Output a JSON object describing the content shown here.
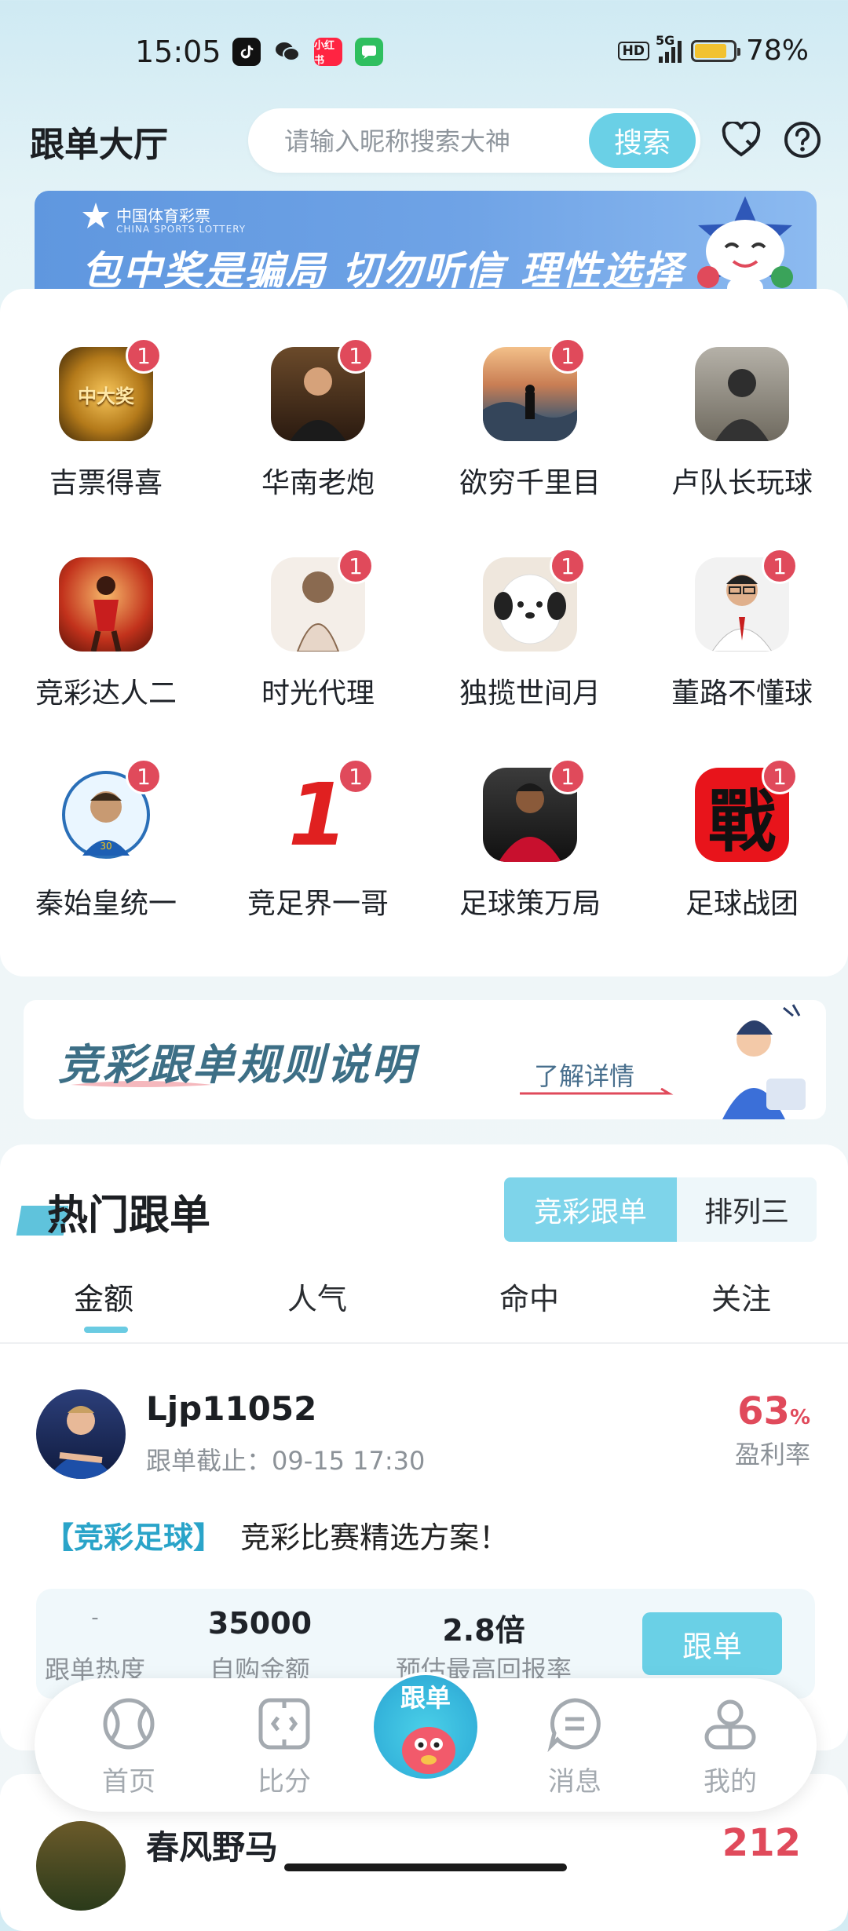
{
  "status_bar": {
    "time": "15:05",
    "network": "5G",
    "hd": "HD",
    "battery": "78%",
    "app_icon_labels": [
      "小红书"
    ]
  },
  "header": {
    "title": "跟单大厅",
    "search_placeholder": "请输入昵称搜索大神",
    "search_button": "搜索"
  },
  "banner": {
    "logo_cn": "中国体育彩票",
    "logo_en": "CHINA SPORTS LOTTERY",
    "slogan": "包中奖是骗局 切勿听信 理性选择"
  },
  "creators": [
    {
      "name": "吉票得喜",
      "badge": "1",
      "avatar_text": "中大奖"
    },
    {
      "name": "华南老炮",
      "badge": "1"
    },
    {
      "name": "欲穷千里目",
      "badge": "1"
    },
    {
      "name": "卢队长玩球",
      "badge": ""
    },
    {
      "name": "竞彩达人二",
      "badge": ""
    },
    {
      "name": "时光代理",
      "badge": "1"
    },
    {
      "name": "独揽世间月",
      "badge": "1"
    },
    {
      "name": "董路不懂球",
      "badge": "1"
    },
    {
      "name": "秦始皇统一",
      "badge": "1"
    },
    {
      "name": "竞足界一哥",
      "badge": "1",
      "avatar_text": "1"
    },
    {
      "name": "足球策万局",
      "badge": "1"
    },
    {
      "name": "足球战团",
      "badge": "1",
      "avatar_text": "戰"
    }
  ],
  "rules_banner": {
    "title": "竞彩跟单规则说明",
    "link": "了解详情"
  },
  "hot": {
    "title": "热门跟单",
    "segments": [
      "竞彩跟单",
      "排列三"
    ],
    "tabs": [
      "金额",
      "人气",
      "命中",
      "关注"
    ],
    "active_tab": "金额"
  },
  "post": {
    "username": "Ljp11052",
    "deadline": "跟单截止：09-15 17:30",
    "profit_value": "63",
    "profit_unit": "%",
    "profit_label": "盈利率",
    "tag": "【竞彩足球】",
    "description": "竞彩比赛精选方案！",
    "stats": [
      {
        "value": "-",
        "label": "跟单热度"
      },
      {
        "value": "35000",
        "label": "自购金额"
      },
      {
        "value": "2.8倍",
        "label": "预估最高回报率"
      }
    ],
    "follow_button": "跟单"
  },
  "next_post": {
    "username": "春风野马",
    "profit_value": "212"
  },
  "bottom_nav": {
    "items": [
      "首页",
      "比分",
      "消息",
      "我的"
    ],
    "center_label": "跟单"
  }
}
